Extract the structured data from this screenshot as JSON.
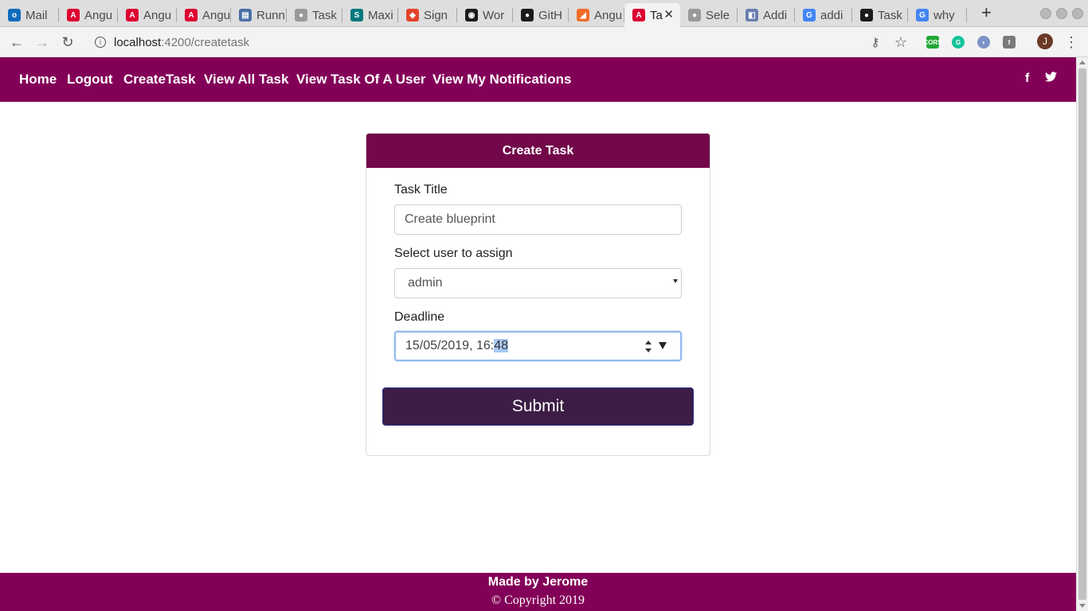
{
  "browser": {
    "tabs": [
      {
        "title": "Mail",
        "icon": "outlook-icon",
        "color": "#0f6cbd",
        "glyph": "o"
      },
      {
        "title": "Angu",
        "icon": "angular-icon",
        "color": "#dd0031",
        "glyph": "A"
      },
      {
        "title": "Angu",
        "icon": "angular-icon",
        "color": "#dd0031",
        "glyph": "A"
      },
      {
        "title": "Angu",
        "icon": "angular-icon",
        "color": "#dd0031",
        "glyph": "A"
      },
      {
        "title": "Runn",
        "icon": "document-icon",
        "color": "#4a6fa5",
        "glyph": "▤"
      },
      {
        "title": "Task",
        "icon": "globe-icon",
        "color": "#9a9a9a",
        "glyph": "●"
      },
      {
        "title": "Maxi",
        "icon": "sharepoint-icon",
        "color": "#03787c",
        "glyph": "S"
      },
      {
        "title": "Sign",
        "icon": "gitlab-icon",
        "color": "#e2432a",
        "glyph": "◆"
      },
      {
        "title": "Wor",
        "icon": "github-icon",
        "color": "#1b1b1b",
        "glyph": "◉"
      },
      {
        "title": "GitH",
        "icon": "github-icon",
        "color": "#1b1b1b",
        "glyph": "●"
      },
      {
        "title": "Angu",
        "icon": "stackblitz-icon",
        "color": "#f26d2a",
        "glyph": "◢"
      },
      {
        "title": "Ta",
        "icon": "angular-icon",
        "color": "#dd0031",
        "glyph": "A",
        "active": true
      },
      {
        "title": "Sele",
        "icon": "globe-icon",
        "color": "#9a9a9a",
        "glyph": "●"
      },
      {
        "title": "Addi",
        "icon": "puzzle-icon",
        "color": "#6a7fb0",
        "glyph": "◧"
      },
      {
        "title": "addi",
        "icon": "google-icon",
        "color": "#4285f4",
        "glyph": "G"
      },
      {
        "title": "Task",
        "icon": "github-icon",
        "color": "#1b1b1b",
        "glyph": "●"
      },
      {
        "title": "why",
        "icon": "google-icon",
        "color": "#4285f4",
        "glyph": "G"
      }
    ],
    "url_host": "localhost",
    "url_path": ":4200/createtask",
    "profile_initial": "J"
  },
  "nav": {
    "home": "Home",
    "logout": "Logout",
    "create_task": "CreateTask",
    "view_all_task": "View All Task",
    "view_task_of_user": "View Task Of A User",
    "view_notifications": "View My Notifications"
  },
  "form": {
    "header": "Create Task",
    "title_label": "Task Title",
    "title_value": "Create blueprint",
    "user_label": "Select user to assign",
    "user_selected": "admin",
    "deadline_label": "Deadline",
    "deadline_value_main": "15/05/2019, 16:",
    "deadline_value_selected": "48",
    "submit_label": "Submit"
  },
  "footer": {
    "made_by": "Made by Jerome",
    "copyright": "Copyright 2019"
  },
  "colors": {
    "brand": "#830058",
    "card_header": "#720749",
    "submit_bg": "#3d1d45"
  }
}
